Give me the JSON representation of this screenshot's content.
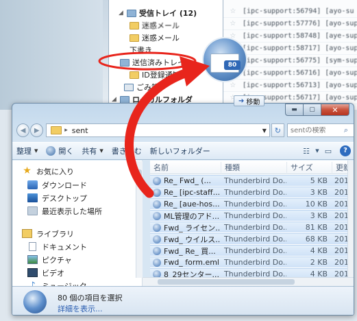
{
  "thunderbird": {
    "folders": [
      {
        "label": "受信トレイ (12)",
        "bold": true
      },
      {
        "label": "迷惑メール"
      },
      {
        "label": "迷惑メール"
      },
      {
        "label": "下書き"
      },
      {
        "label": "送信済みトレイ"
      },
      {
        "label": "ID登録通知"
      },
      {
        "label": "ごみ箱"
      },
      {
        "label": "ローカルフォルダ",
        "bold": true
      }
    ],
    "messages": [
      "[ipc-support:56794] [ayo-su",
      "[ipc-support:57776] [ayo-sup",
      "[ipc-support:58748] [aye-sup",
      "[ipc-support:58717] [ayo-sup",
      "[ipc-support:56775] [sym-sup",
      "[ipc-support:56716] [ayo-sup",
      "[ipc-support:56713] [ayo-sup",
      "[ipc-support:56717] [ayo-sup"
    ],
    "logo_badge": "80",
    "move_button": "移動"
  },
  "explorer": {
    "window_buttons": {
      "minimize": "▬",
      "maximize": "▢",
      "close": "✕"
    },
    "address": {
      "folder": "sent"
    },
    "search": {
      "placeholder": "sentの検索"
    },
    "toolbar": {
      "organize": "整理",
      "open": "開く",
      "share": "共有",
      "burn": "書き込む",
      "new_folder": "新しいフォルダー"
    },
    "nav": {
      "favorites": "お気に入り",
      "downloads": "ダウンロード",
      "desktop": "デスクトップ",
      "recent": "最近表示した場所",
      "libraries": "ライブラリ",
      "documents": "ドキュメント",
      "pictures": "ピクチャ",
      "videos": "ビデオ",
      "music": "ミュージック"
    },
    "columns": {
      "name": "名前",
      "type": "種類",
      "size": "サイズ",
      "date": "更新"
    },
    "files": [
      {
        "name": "Re_ Fwd_ (...",
        "type": "Thunderbird Do...",
        "size": "5 KB",
        "date": "201"
      },
      {
        "name": "Re_ [ipc-staff...",
        "type": "Thunderbird Do...",
        "size": "3 KB",
        "date": "201"
      },
      {
        "name": "Re_ [aue-hos...",
        "type": "Thunderbird Do...",
        "size": "10 KB",
        "date": "201"
      },
      {
        "name": "ML管理のアド...",
        "type": "Thunderbird Do...",
        "size": "3 KB",
        "date": "201"
      },
      {
        "name": "Fwd_ ライセン...",
        "type": "Thunderbird Do...",
        "size": "81 KB",
        "date": "201"
      },
      {
        "name": "Fwd_ ウイルス...",
        "type": "Thunderbird Do...",
        "size": "68 KB",
        "date": "201"
      },
      {
        "name": "Fwd_ Re_ 買...",
        "type": "Thunderbird Do...",
        "size": "4 KB",
        "date": "201"
      },
      {
        "name": "Fwd_ form.eml",
        "type": "Thunderbird Do...",
        "size": "2 KB",
        "date": "201"
      },
      {
        "name": "8_29センター...",
        "type": "Thunderbird Do...",
        "size": "4 KB",
        "date": "201"
      }
    ],
    "details": {
      "count": "80 個の項目を選択",
      "more": "詳細を表示..."
    }
  },
  "colors": {
    "arrow": "#e8251c",
    "selection": "#cfe2f7",
    "accent": "#2a5db0"
  }
}
